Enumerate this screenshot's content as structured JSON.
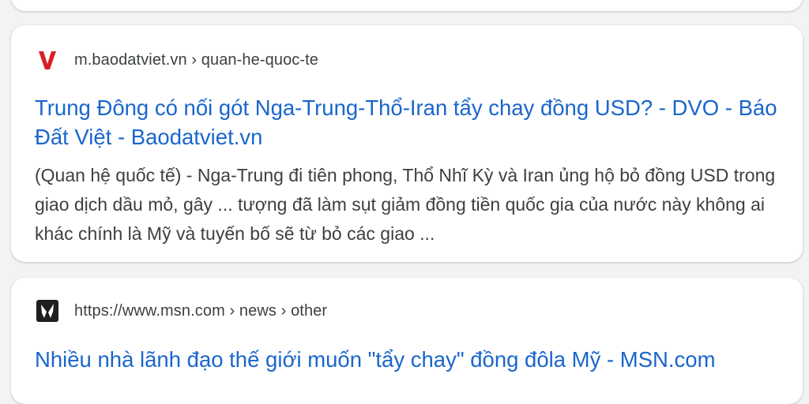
{
  "results": [
    {
      "favicon": "v-letter-icon",
      "source": "m.baodatviet.vn › quan-he-quoc-te",
      "title": "Trung Đông có nối gót Nga-Trung-Thổ-Iran tẩy chay đồng USD? - DVO - Báo Đất Việt - Baodatviet.vn",
      "snippet": "(Quan hệ quốc tế) - Nga-Trung đi tiên phong, Thổ Nhĩ Kỳ và Iran ủng hộ bỏ đồng USD trong giao dịch dầu mỏ, gây ... tượng đã làm sụt giảm đồng tiền quốc gia của nước này không ai khác chính là Mỹ và tuyến bố sẽ từ bỏ các giao ..."
    },
    {
      "favicon": "msn-butterfly-icon",
      "source": "https://www.msn.com › news › other",
      "title": "Nhiều nhà lãnh đạo thế giới muốn \"tẩy chay\" đồng đôla Mỹ - MSN.com"
    }
  ],
  "colors": {
    "link": "#1a66cc",
    "text": "#3c4043",
    "favicon_v": "#d81f26",
    "background": "#f1f3f4"
  }
}
